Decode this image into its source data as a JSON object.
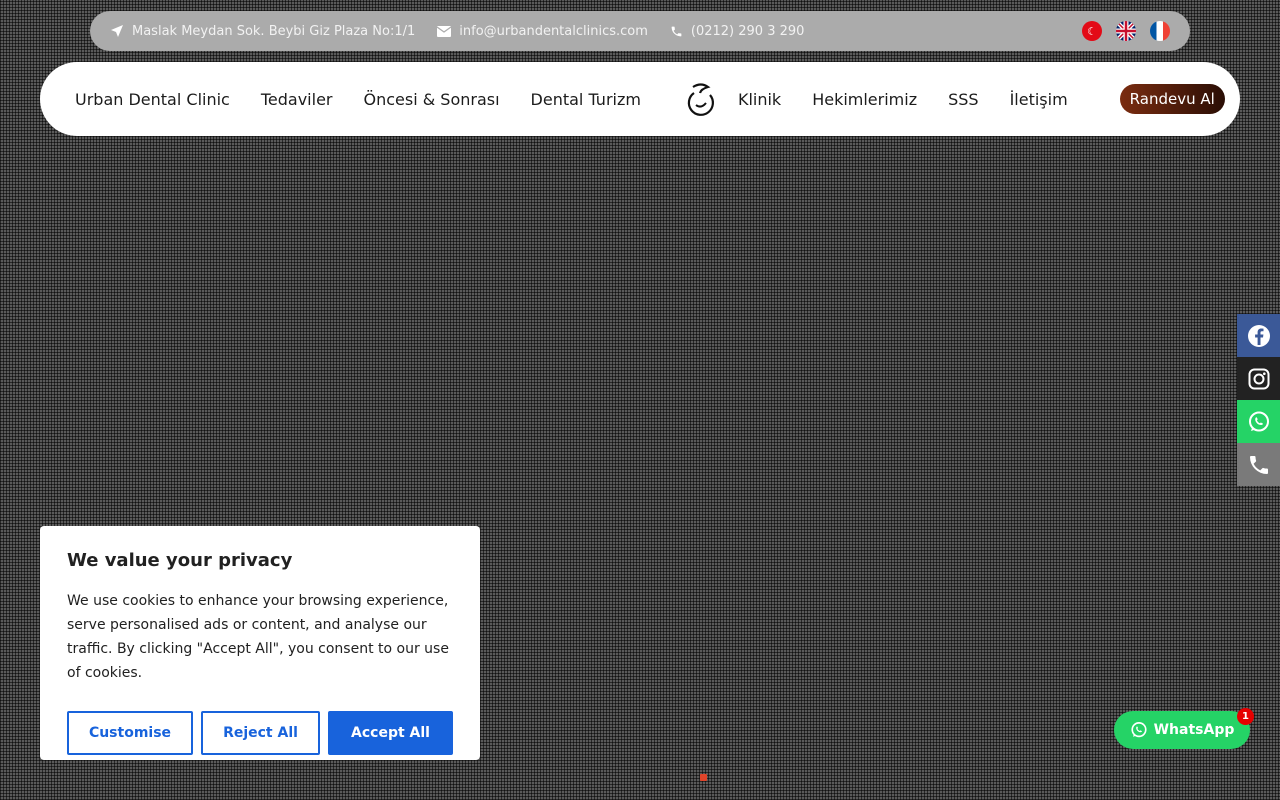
{
  "topbar": {
    "address": "Maslak Meydan Sok. Beybi Giz Plaza No:1/1",
    "email": "info@urbandentalclinics.com",
    "phone": "(0212) 290 3 290",
    "flags": [
      "tr",
      "en",
      "fr"
    ]
  },
  "nav": {
    "left": [
      "Urban Dental Clinic",
      "Tedaviler",
      "Öncesi & Sonrası",
      "Dental Turizm"
    ],
    "right": [
      "Klinik",
      "Hekimlerimiz",
      "SSS",
      "İletişim"
    ],
    "cta": "Randevu Al"
  },
  "social": [
    "facebook-icon",
    "instagram-icon",
    "whatsapp-icon",
    "phone-icon"
  ],
  "cookie": {
    "title": "We value your privacy",
    "text": "We use cookies to enhance your browsing experience, serve personalised ads or content, and analyse our traffic. By clicking \"Accept All\", you consent to our use of cookies.",
    "customise": "Customise",
    "reject": "Reject All",
    "accept": "Accept All"
  },
  "whatsapp": {
    "label": "WhatsApp",
    "badge": "1"
  },
  "colors": {
    "primary": "#1863dc",
    "whatsapp": "#25d366",
    "cta": "#7a2c10"
  }
}
